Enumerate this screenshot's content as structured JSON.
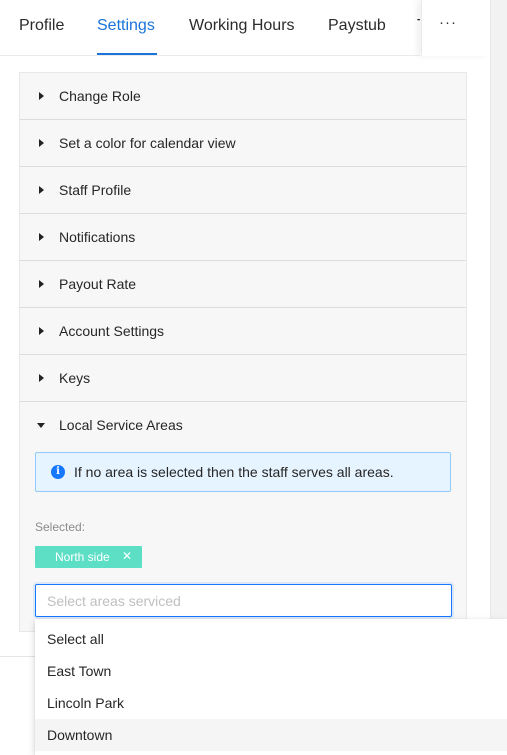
{
  "tabs": [
    {
      "label": "Profile"
    },
    {
      "label": "Settings"
    },
    {
      "label": "Working Hours"
    },
    {
      "label": "Paystub"
    },
    {
      "label": "T"
    }
  ],
  "active_tab": "Settings",
  "more_button": {
    "label": "···"
  },
  "accordion": {
    "items": [
      {
        "label": "Change Role",
        "expanded": false
      },
      {
        "label": "Set a color for calendar view",
        "expanded": false
      },
      {
        "label": "Staff Profile",
        "expanded": false
      },
      {
        "label": "Notifications",
        "expanded": false
      },
      {
        "label": "Payout Rate",
        "expanded": false
      },
      {
        "label": "Account Settings",
        "expanded": false
      },
      {
        "label": "Keys",
        "expanded": false
      },
      {
        "label": "Local Service Areas",
        "expanded": true
      }
    ]
  },
  "service_areas": {
    "info_icon": "i",
    "info_text": "If no area is selected then the staff serves all areas.",
    "selected_label": "Selected:",
    "selected_tags": [
      {
        "label": "North side",
        "close_icon": "✕"
      }
    ],
    "select_placeholder": "Select areas serviced",
    "select_value": ""
  },
  "dropdown": {
    "options": [
      {
        "label": "Select all",
        "active": false
      },
      {
        "label": "East Town",
        "active": false
      },
      {
        "label": "Lincoln Park",
        "active": false
      },
      {
        "label": "Downtown",
        "active": true
      }
    ]
  },
  "colors": {
    "primary": "#1a73d9",
    "tag": "#5ddfc6",
    "info_bg": "#e6f4ff",
    "info_border": "#91caff"
  }
}
